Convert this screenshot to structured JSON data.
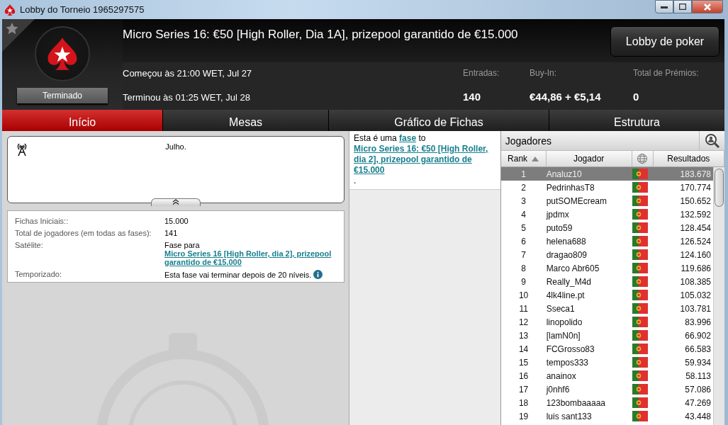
{
  "window": {
    "title": "Lobby do Torneio 1965297575"
  },
  "header": {
    "title": "Micro Series 16: €50 [High Roller, Dia 1A], prizepool garantido de €15.000",
    "status": "Terminado",
    "favorite": false,
    "lobby_button": "Lobby de poker",
    "dates": [
      "Começou às 21:00 WET, Jul 27",
      "Terminou às 01:25 WET, Jul 28"
    ],
    "stats": [
      {
        "label": "Entradas:",
        "value": "140"
      },
      {
        "label": "Buy-In:",
        "value": "€44,86 + €5,14"
      },
      {
        "label": "Total de Prémios:",
        "value": "0"
      }
    ]
  },
  "tabs": [
    {
      "label": "Início",
      "selected": true
    },
    {
      "label": "Mesas",
      "selected": false
    },
    {
      "label": "Gráfico de Fichas",
      "selected": false
    },
    {
      "label": "Estrutura",
      "selected": false
    }
  ],
  "news": {
    "text": "Julho."
  },
  "details": [
    {
      "label": "Fichas Iniciais::",
      "parts": [
        {
          "kind": "text",
          "text": "15.000"
        }
      ]
    },
    {
      "label": "Total de jogadores (em todas as fases):",
      "parts": [
        {
          "kind": "text",
          "text": "141"
        }
      ]
    },
    {
      "label": "Satélite:",
      "parts": [
        {
          "kind": "text",
          "text": "Fase para "
        },
        {
          "kind": "link",
          "text": "Micro Series 16 [High Roller, dia 2], prizepool garantido de €15.000"
        }
      ]
    },
    {
      "label": "Temporizado:",
      "parts": [
        {
          "kind": "text",
          "text": "Esta fase vai terminar depois de 20 níveis."
        },
        {
          "kind": "info"
        }
      ]
    }
  ],
  "phase_note": [
    {
      "kind": "text",
      "text": "Esta é uma "
    },
    {
      "kind": "link",
      "text": "fase"
    },
    {
      "kind": "text",
      "text": " to "
    },
    {
      "kind": "link",
      "text": "Micro Series 16: €50 [High Roller, dia 2], prizepool garantido de €15.000"
    },
    {
      "kind": "text",
      "text": "."
    }
  ],
  "players": {
    "title": "Jogadores",
    "columns": [
      {
        "kind": "text",
        "label": "Rank",
        "sorted": true
      },
      {
        "kind": "text",
        "label": "Jogador",
        "sorted": false
      },
      {
        "kind": "country"
      },
      {
        "kind": "text",
        "label": "Resultados",
        "sorted": false
      }
    ],
    "rows": [
      {
        "rank": "1",
        "name": "Analuz10",
        "result": "183.678",
        "selected": true
      },
      {
        "rank": "2",
        "name": "PedrinhasT8",
        "result": "170.774",
        "selected": false
      },
      {
        "rank": "3",
        "name": "putSOMEcream",
        "result": "150.652",
        "selected": false
      },
      {
        "rank": "4",
        "name": "jpdmx",
        "result": "132.592",
        "selected": false
      },
      {
        "rank": "5",
        "name": "puto59",
        "result": "128.454",
        "selected": false
      },
      {
        "rank": "6",
        "name": "helena688",
        "result": "126.524",
        "selected": false
      },
      {
        "rank": "7",
        "name": "dragao809",
        "result": "124.160",
        "selected": false
      },
      {
        "rank": "8",
        "name": "Marco Abr605",
        "result": "119.686",
        "selected": false
      },
      {
        "rank": "9",
        "name": "Really_M4d",
        "result": "108.385",
        "selected": false
      },
      {
        "rank": "10",
        "name": "4lk4line.pt",
        "result": "105.032",
        "selected": false
      },
      {
        "rank": "11",
        "name": "Sseca1",
        "result": "103.781",
        "selected": false
      },
      {
        "rank": "12",
        "name": "linopolido",
        "result": "83.996",
        "selected": false
      },
      {
        "rank": "13",
        "name": "[lamN0n]",
        "result": "66.902",
        "selected": false
      },
      {
        "rank": "14",
        "name": "FCGrosso83",
        "result": "66.583",
        "selected": false
      },
      {
        "rank": "15",
        "name": "tempos333",
        "result": "59.934",
        "selected": false
      },
      {
        "rank": "16",
        "name": "anainox",
        "result": "58.113",
        "selected": false
      },
      {
        "rank": "17",
        "name": "j0nhf6",
        "result": "57.086",
        "selected": false
      },
      {
        "rank": "18",
        "name": "123bombaaaaa",
        "result": "47.269",
        "selected": false
      },
      {
        "rank": "19",
        "name": "luis sant133",
        "result": "43.448",
        "selected": false
      }
    ]
  }
}
